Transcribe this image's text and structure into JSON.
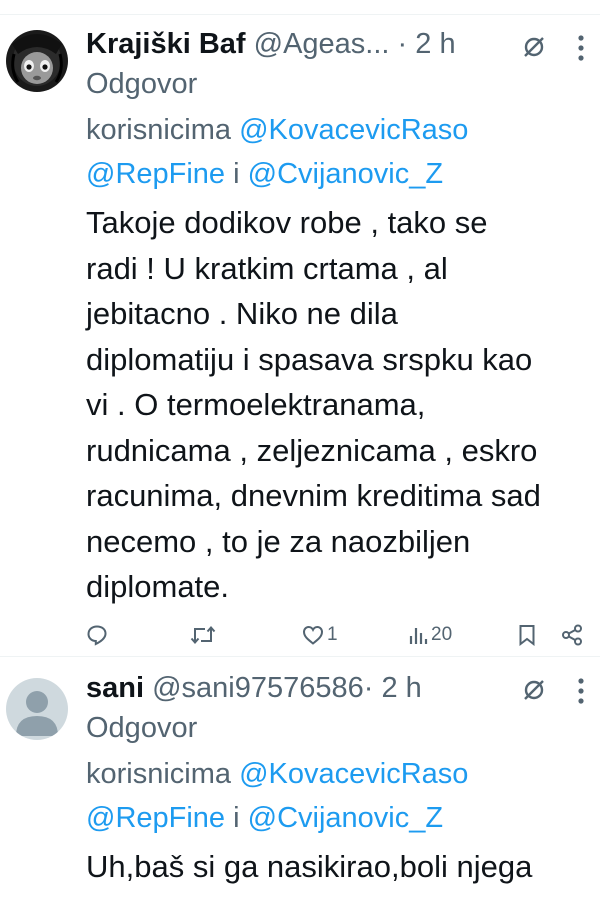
{
  "tweets": [
    {
      "name": "Krajiški Baf",
      "handle": "@Ageas...",
      "separator": "·",
      "time": "2 h",
      "reply_label": "Odgovor",
      "reply_prefix": "korisnicima",
      "mention1": "@KovacevicRaso",
      "mention2": "@RepFine",
      "reply_and": "i",
      "mention3": "@Cvijanovic_Z",
      "text_lines": [
        "Takoje dodikov robe , tako se",
        "radi ! U kratkim crtama , al",
        "jebitacno . Niko ne dila",
        "diplomatiju i spasava srspku kao",
        "vi . O termoelektranama,",
        "rudnicama , zeljeznicama , eskro",
        "racunima, dnevnim kreditima sad",
        "necemo , to je za naozbiljen",
        "diplomate."
      ],
      "actions": {
        "reply_count": "",
        "retweet_count": "",
        "like_count": "1",
        "view_count": "20"
      },
      "icons": [
        "reply-icon",
        "retweet-icon",
        "like-icon",
        "views-icon",
        "bookmark-icon",
        "share-icon",
        "mute-icon",
        "more-icon"
      ]
    },
    {
      "name": "sani",
      "handle": "@sani97576586",
      "separator": "·",
      "time": "2 h",
      "reply_label": "Odgovor",
      "reply_prefix": "korisnicima",
      "mention1": "@KovacevicRaso",
      "mention2": "@RepFine",
      "reply_and": "i",
      "mention3": "@Cvijanovic_Z",
      "text_lines": [
        "Uh,baš si ga nasikirao,boli njega"
      ]
    }
  ],
  "colors": {
    "text": "#0f1419",
    "secondary": "#536471",
    "link": "#1d9bf0",
    "divider": "#eff3f4"
  }
}
